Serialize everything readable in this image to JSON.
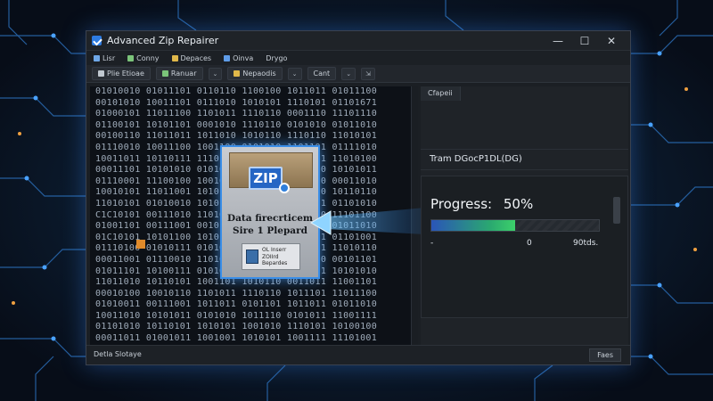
{
  "window": {
    "title": "Advanced Zip Repairer",
    "controls": {
      "minimize": "—",
      "maximize": "☐",
      "close": "✕"
    }
  },
  "menu": {
    "items": [
      {
        "label": "Lisr",
        "icon": "list-icon",
        "color": "#6fa8e8"
      },
      {
        "label": "Conny",
        "icon": "copy-icon",
        "color": "#7bc47a"
      },
      {
        "label": "Depaces",
        "icon": "folder-icon",
        "color": "#e0b84a"
      },
      {
        "label": "Oinva",
        "icon": "window-icon",
        "color": "#5f9ce8"
      },
      {
        "label": "Drygo",
        "icon": "",
        "color": ""
      }
    ]
  },
  "toolbar": {
    "buttons": [
      {
        "label": "Plie Etioae",
        "icon": "file-icon",
        "color": "#c0c8d0"
      },
      {
        "label": "Ranuar",
        "icon": "repair-icon",
        "color": "#7bc47a"
      },
      {
        "label": "Nepaodis",
        "icon": "archive-icon",
        "color": "#e0b84a"
      }
    ],
    "caret": "⌄",
    "extra_label": "Cant",
    "end_icon": "⇲"
  },
  "binary_lines": [
    "01010010 01011101 0110110 1100100 1011011 01011100",
    "00101010 10011101 0111010 1010101 1110101 01101671",
    "01000101 11011100 1101011 1110110 0001110 11101110",
    "01100101 10101101 0001010 1110110 0101010 01011010",
    "00100110 11011011 1011010 1010110 1110110 11010101",
    "01110010 10011100 1001100 0101010 1101101 01111010",
    "10011011 10110111 1110101 1010111 1010101 11010100",
    "00011101 10101010 0101010 1110101 0110010 10101011",
    "01110001 11100100 1001001 1010101 0001000 00011010",
    "10010101 11011001 1010110 1101010 1101010 10110110",
    "11010101 01010010 1010100 1101010 1101011 01101010",
    "C1C10101 00111010 1101010 1011010 1111010 11101100",
    "01001101 00111001 0010101 1011001 1100101 01011010",
    "01C10101 10101100 1010110 1010101 1101101 01101001",
    "01110100 01010111 0101011 0101011 1011001 11010110",
    "00011001 01110010 1101010 1010101 1101010 00101101",
    "01011101 10100111 0101010 0001110 1010101 10101010",
    "11011010 10110101 1001101 1010110 0011011 11001101",
    "00010100 10010110 1101011 1110110 1011101 11011100",
    "01010011 00111001 1011011 0101101 1011011 01011010",
    "10011010 10101011 0101010 1011110 0101011 11001111",
    "01101010 10110101 1010101 1001010 1110101 10100100",
    "00011011 01001011 1001001 1010101 1001111 11101001"
  ],
  "zip_card": {
    "logo_text": "ZIP",
    "line1": "Data firecrticem",
    "line2": "Sire 1 Plepard",
    "badge_lines": [
      "OL Inserr",
      "ZOIIrd",
      "Bepardes"
    ]
  },
  "right_panel": {
    "tab_label": "Cfapeii",
    "file_text": "Tram DGocP1DL(DG)",
    "progress_label": "Progress:",
    "progress_percent": "50%",
    "progress_value": 0.5,
    "foot_left": "-",
    "foot_mid": "0",
    "foot_right": "90tds."
  },
  "status": {
    "text": "Detla Slotaye",
    "button": "Faes"
  },
  "colors": {
    "accent": "#3a8ee8",
    "progress_start": "#2a55b8",
    "progress_end": "#3cd06a"
  }
}
